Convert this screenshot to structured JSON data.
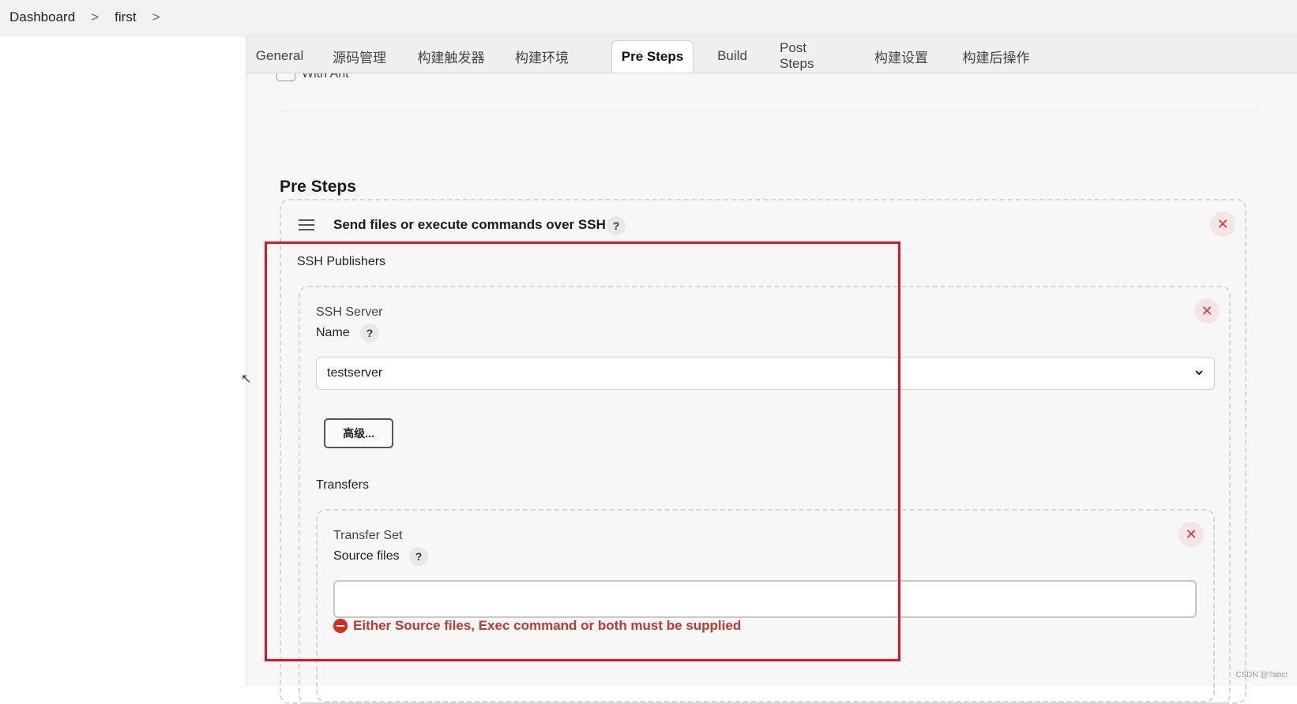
{
  "breadcrumb": {
    "items": [
      "Dashboard",
      "first"
    ],
    "separator": ">"
  },
  "tabs": [
    {
      "label": "General"
    },
    {
      "label": "源码管理"
    },
    {
      "label": "构建触发器"
    },
    {
      "label": "构建环境"
    },
    {
      "label": "Pre Steps",
      "active": true
    },
    {
      "label": "Build"
    },
    {
      "label": "Post Steps"
    },
    {
      "label": "构建设置"
    },
    {
      "label": "构建后操作"
    }
  ],
  "partial_option": {
    "label": "With Ant"
  },
  "section": {
    "title": "Pre Steps"
  },
  "step": {
    "title": "Send files or execute commands over SSH",
    "help": "?",
    "close": "✕"
  },
  "publishers": {
    "label": "SSH Publishers",
    "server": {
      "section_label": "SSH Server",
      "name_label": "Name",
      "help": "?",
      "close": "✕",
      "selected": "testserver",
      "advanced_label": "高级..."
    },
    "transfers": {
      "label": "Transfers",
      "set_label": "Transfer Set",
      "source_label": "Source files",
      "help": "?",
      "close": "✕",
      "source_value": "",
      "error": "Either Source files, Exec command or both must be supplied"
    }
  },
  "cursor": "↖",
  "watermark": "CSDN @?abc!",
  "colors": {
    "highlight": "#e3141e",
    "error": "#c0392b",
    "active_tab_bg": "#ffffff"
  }
}
